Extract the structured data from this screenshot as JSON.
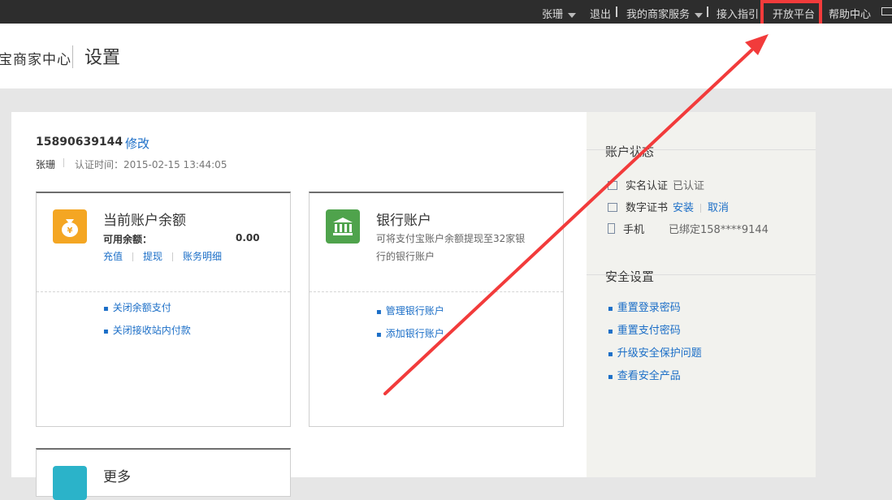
{
  "topbar": {
    "user": "张珊",
    "logout": "退出",
    "merchant_services": "我的商家服务",
    "access_guide": "接入指引",
    "open_platform": "开放平台",
    "help_center": "帮助中心"
  },
  "header": {
    "brand": "宝商家中心",
    "title": "设置"
  },
  "account": {
    "phone": "15890639144",
    "edit": "修改",
    "name": "张珊",
    "cert_time": "认证时间：2015-02-15 13:44:05"
  },
  "balance_card": {
    "title": "当前账户余额",
    "available_label": "可用余额：",
    "available_value": "0.00",
    "actions": [
      "充值",
      "提现",
      "账务明细"
    ],
    "links": [
      "关闭余额支付",
      "关闭接收站内付款"
    ]
  },
  "bank_card": {
    "title": "银行账户",
    "desc_line1": "可将支付宝账户余额提现至32家银",
    "desc_line2": "行的银行账户",
    "links": [
      "管理银行账户",
      "添加银行账户"
    ]
  },
  "more_card": {
    "title": "更多"
  },
  "sidebar": {
    "status_title": "账户状态",
    "real_name": {
      "label": "实名认证",
      "value": "已认证"
    },
    "digital_cert": {
      "label": "数字证书",
      "install": "安装",
      "cancel": "取消"
    },
    "mobile": {
      "label": "手机",
      "value": "已绑定158****9144"
    },
    "security_title": "安全设置",
    "security_links": [
      "重置登录密码",
      "重置支付密码",
      "升级安全保护问题",
      "查看安全产品"
    ]
  },
  "colors": {
    "accent_link": "#1b6ec7",
    "highlight": "#f23b3b",
    "topbar_bg": "#2d2d2d",
    "balance_icon": "#f4a623",
    "bank_icon": "#4fa34c"
  }
}
